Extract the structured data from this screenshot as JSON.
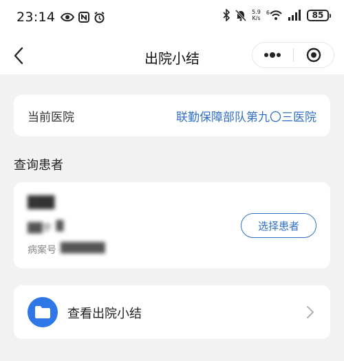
{
  "status_bar": {
    "time": "23:14",
    "network_speed_value": "5.9",
    "network_speed_unit": "K/s",
    "wifi_label": "6",
    "battery": "85"
  },
  "nav": {
    "title": "出院小结"
  },
  "hospital": {
    "label": "当前医院",
    "value": "联勤保障部队第九〇三医院"
  },
  "patient_section": {
    "title": "查询患者",
    "name": "███",
    "age": "██岁",
    "gender": "█",
    "case_label": "病案号",
    "case_number": "██████",
    "select_button": "选择患者"
  },
  "summary": {
    "label": "查看出院小结"
  },
  "colors": {
    "accent": "#2f6fc6",
    "folder": "#2f76e6",
    "background": "#f2f2f2"
  }
}
